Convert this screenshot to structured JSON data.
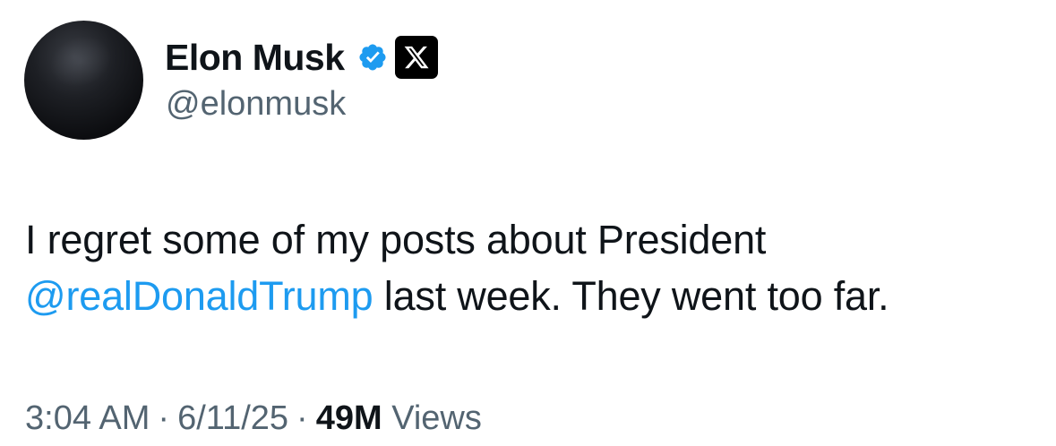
{
  "author": {
    "display_name": "Elon Musk",
    "handle": "@elonmusk",
    "avatar_icon": "avatar",
    "verified_icon": "verified-badge-icon",
    "affiliation_icon": "x-logo-icon",
    "verified_color": "#1d9bf0"
  },
  "tweet": {
    "text_part1": "I regret some of my posts about President ",
    "mention": "@realDonaldTrump",
    "text_part2": " last week. They went too far.",
    "mention_color": "#1d9bf0"
  },
  "meta": {
    "time": "3:04 AM",
    "separator": "·",
    "date": "6/11/25",
    "views_count": "49M",
    "views_label": "Views"
  }
}
